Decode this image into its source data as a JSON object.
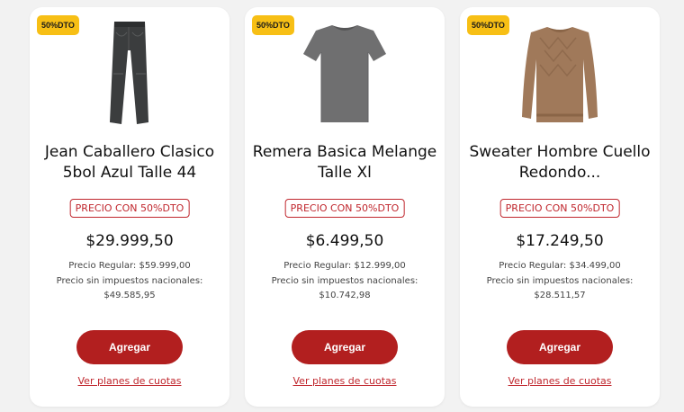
{
  "products": [
    {
      "badge": "50%DTO",
      "image_icon": "jeans-icon",
      "title": "Jean Caballero Clasico 5bol Azul Talle 44",
      "tag": "PRECIO CON 50%DTO",
      "price": "$29.999,50",
      "regular": "Precio Regular: $59.999,00",
      "tax_label": "Precio sin impuestos nacionales:",
      "tax_value": "$49.585,95",
      "button": "Agregar",
      "link": "Ver planes de cuotas"
    },
    {
      "badge": "50%DTO",
      "image_icon": "tshirt-icon",
      "title": "Remera Basica Melange Talle Xl",
      "tag": "PRECIO CON 50%DTO",
      "price": "$6.499,50",
      "regular": "Precio Regular: $12.999,00",
      "tax_label": "Precio sin impuestos nacionales:",
      "tax_value": "$10.742,98",
      "button": "Agregar",
      "link": "Ver planes de cuotas"
    },
    {
      "badge": "50%DTO",
      "image_icon": "sweater-icon",
      "title": "Sweater Hombre Cuello Redondo...",
      "tag": "PRECIO CON 50%DTO",
      "price": "$17.249,50",
      "regular": "Precio Regular: $34.499,00",
      "tax_label": "Precio sin impuestos nacionales:",
      "tax_value": "$28.511,57",
      "button": "Agregar",
      "link": "Ver planes de cuotas"
    }
  ],
  "colors": {
    "badge": "#f7bf15",
    "accent": "#b21f1f",
    "tag_border": "#c0262d"
  }
}
